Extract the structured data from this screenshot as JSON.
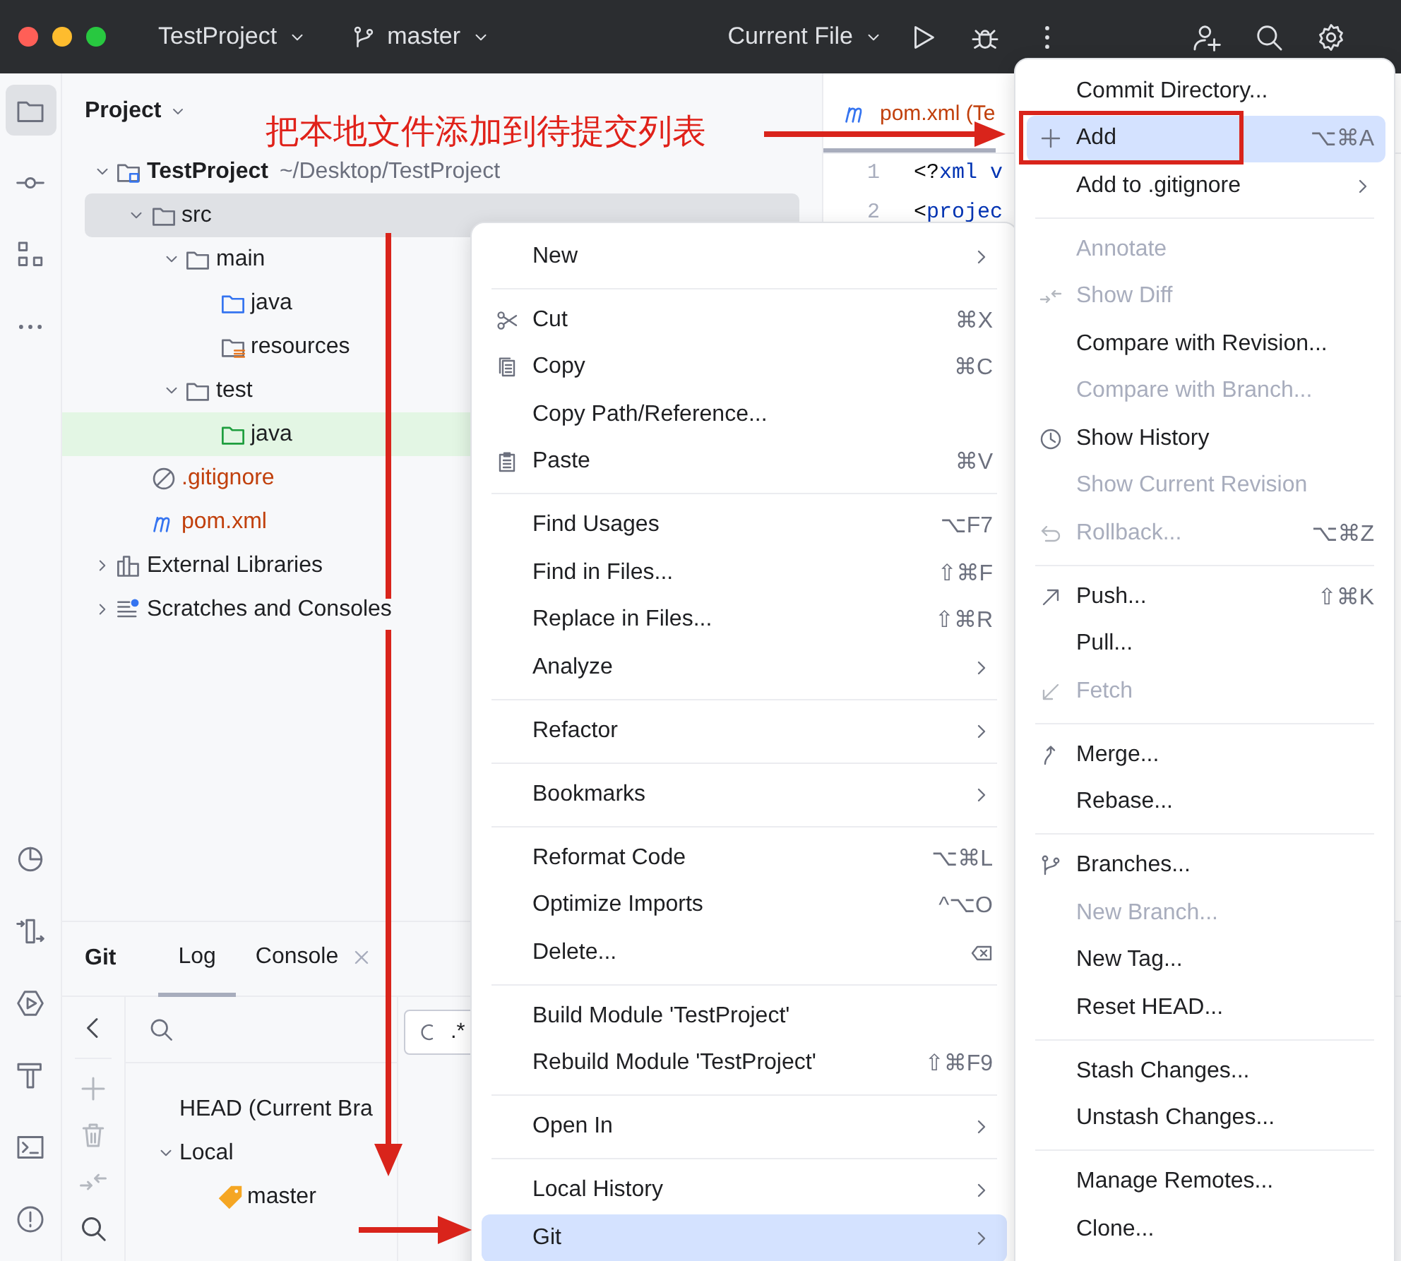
{
  "titlebar": {
    "project": "TestProject",
    "branch": "master",
    "run_config": "Current File"
  },
  "project_panel": {
    "title": "Project",
    "tree": [
      {
        "label": "TestProject",
        "path": "~/Desktop/TestProject",
        "kind": "module",
        "expanded": true,
        "selected": false,
        "untracked": false,
        "children": [
          {
            "label": "src",
            "kind": "folder",
            "expanded": true,
            "selected": true,
            "untracked": false,
            "children": [
              {
                "label": "main",
                "kind": "folder",
                "expanded": true,
                "selected": false,
                "untracked": false,
                "children": [
                  {
                    "label": "java",
                    "kind": "source_folder",
                    "selected": false,
                    "untracked": false
                  },
                  {
                    "label": "resources",
                    "kind": "resource_folder",
                    "selected": false,
                    "untracked": false
                  }
                ]
              },
              {
                "label": "test",
                "kind": "folder",
                "expanded": true,
                "selected": false,
                "untracked": false,
                "children": [
                  {
                    "label": "java",
                    "kind": "test_folder",
                    "selected": false,
                    "untracked": false
                  }
                ]
              }
            ]
          },
          {
            "label": ".gitignore",
            "kind": "ignore_file",
            "selected": false,
            "untracked": true
          },
          {
            "label": "pom.xml",
            "kind": "maven_file",
            "selected": false,
            "untracked": true
          }
        ]
      },
      {
        "label": "External Libraries",
        "kind": "libraries",
        "expanded": false,
        "selected": false,
        "untracked": false
      },
      {
        "label": "Scratches and Consoles",
        "kind": "scratches",
        "expanded": false,
        "selected": false,
        "untracked": false
      }
    ]
  },
  "editor": {
    "tab": {
      "label": "pom.xml (Te",
      "selected": true,
      "untracked": true
    },
    "lines": [
      {
        "number": "1",
        "tokens": [
          {
            "text": "<?",
            "kind": "punct"
          },
          {
            "text": "xml v",
            "kind": "keyword"
          }
        ]
      },
      {
        "number": "2",
        "tokens": [
          {
            "text": "<",
            "kind": "punct"
          },
          {
            "text": "projec",
            "kind": "keyword"
          }
        ]
      }
    ]
  },
  "git_panel": {
    "title": "Git",
    "tabs": [
      {
        "label": "Log",
        "selected": true,
        "closable": false
      },
      {
        "label": "Console",
        "selected": false,
        "closable": true
      }
    ],
    "regex": ".*",
    "branches": [
      {
        "label": "HEAD (Current Bra"
      },
      {
        "label": "Local",
        "expanded": true,
        "children": [
          {
            "label": "master",
            "kind": "branch"
          }
        ]
      }
    ]
  },
  "context_menu": {
    "groups": [
      [
        {
          "label": "New",
          "submenu": true,
          "selected": false
        }
      ],
      [
        {
          "label": "Cut",
          "shortcut": "⌘X",
          "submenu": false,
          "selected": false
        },
        {
          "label": "Copy",
          "shortcut": "⌘C",
          "submenu": false,
          "selected": false
        },
        {
          "label": "Copy Path/Reference...",
          "submenu": false,
          "selected": false
        },
        {
          "label": "Paste",
          "shortcut": "⌘V",
          "submenu": false,
          "selected": false
        }
      ],
      [
        {
          "label": "Find Usages",
          "shortcut": "⌥F7",
          "submenu": false,
          "selected": false
        },
        {
          "label": "Find in Files...",
          "shortcut": "⇧⌘F",
          "submenu": false,
          "selected": false
        },
        {
          "label": "Replace in Files...",
          "shortcut": "⇧⌘R",
          "submenu": false,
          "selected": false
        },
        {
          "label": "Analyze",
          "submenu": true,
          "selected": false
        }
      ],
      [
        {
          "label": "Refactor",
          "submenu": true,
          "selected": false
        }
      ],
      [
        {
          "label": "Bookmarks",
          "submenu": true,
          "selected": false
        }
      ],
      [
        {
          "label": "Reformat Code",
          "shortcut": "⌥⌘L",
          "submenu": false,
          "selected": false
        },
        {
          "label": "Optimize Imports",
          "shortcut": "^⌥O",
          "submenu": false,
          "selected": false
        },
        {
          "label": "Delete...",
          "submenu": false,
          "selected": false
        }
      ],
      [
        {
          "label": "Build Module 'TestProject'",
          "submenu": false,
          "selected": false
        },
        {
          "label": "Rebuild Module 'TestProject'",
          "shortcut": "⇧⌘F9",
          "submenu": false,
          "selected": false
        }
      ],
      [
        {
          "label": "Open In",
          "submenu": true,
          "selected": false
        }
      ],
      [
        {
          "label": "Local History",
          "submenu": true,
          "selected": false
        },
        {
          "label": "Git",
          "submenu": true,
          "selected": true
        }
      ]
    ]
  },
  "git_menu": {
    "groups": [
      [
        {
          "label": "Commit Directory...",
          "submenu": false,
          "selected": false,
          "disabled": false
        },
        {
          "label": "Add",
          "shortcut": "⌥⌘A",
          "submenu": false,
          "selected": true,
          "disabled": false
        },
        {
          "label": "Add to .gitignore",
          "submenu": true,
          "selected": false,
          "disabled": false
        }
      ],
      [
        {
          "label": "Annotate",
          "submenu": false,
          "selected": false,
          "disabled": true
        },
        {
          "label": "Show Diff",
          "submenu": false,
          "selected": false,
          "disabled": true
        },
        {
          "label": "Compare with Revision...",
          "submenu": false,
          "selected": false,
          "disabled": false
        },
        {
          "label": "Compare with Branch...",
          "submenu": false,
          "selected": false,
          "disabled": true
        },
        {
          "label": "Show History",
          "submenu": false,
          "selected": false,
          "disabled": false
        },
        {
          "label": "Show Current Revision",
          "submenu": false,
          "selected": false,
          "disabled": true
        },
        {
          "label": "Rollback...",
          "shortcut": "⌥⌘Z",
          "submenu": false,
          "selected": false,
          "disabled": true
        }
      ],
      [
        {
          "label": "Push...",
          "shortcut": "⇧⌘K",
          "submenu": false,
          "selected": false,
          "disabled": false
        },
        {
          "label": "Pull...",
          "submenu": false,
          "selected": false,
          "disabled": false
        },
        {
          "label": "Fetch",
          "submenu": false,
          "selected": false,
          "disabled": true
        }
      ],
      [
        {
          "label": "Merge...",
          "submenu": false,
          "selected": false,
          "disabled": false
        },
        {
          "label": "Rebase...",
          "submenu": false,
          "selected": false,
          "disabled": false
        }
      ],
      [
        {
          "label": "Branches...",
          "submenu": false,
          "selected": false,
          "disabled": false
        },
        {
          "label": "New Branch...",
          "submenu": false,
          "selected": false,
          "disabled": true
        },
        {
          "label": "New Tag...",
          "submenu": false,
          "selected": false,
          "disabled": false
        },
        {
          "label": "Reset HEAD...",
          "submenu": false,
          "selected": false,
          "disabled": false
        }
      ],
      [
        {
          "label": "Stash Changes...",
          "submenu": false,
          "selected": false,
          "disabled": false
        },
        {
          "label": "Unstash Changes...",
          "submenu": false,
          "selected": false,
          "disabled": false
        }
      ],
      [
        {
          "label": "Manage Remotes...",
          "submenu": false,
          "selected": false,
          "disabled": false
        },
        {
          "label": "Clone...",
          "submenu": false,
          "selected": false,
          "disabled": false
        }
      ]
    ]
  },
  "annotation": {
    "text": "把本地文件添加到待提交列表"
  }
}
